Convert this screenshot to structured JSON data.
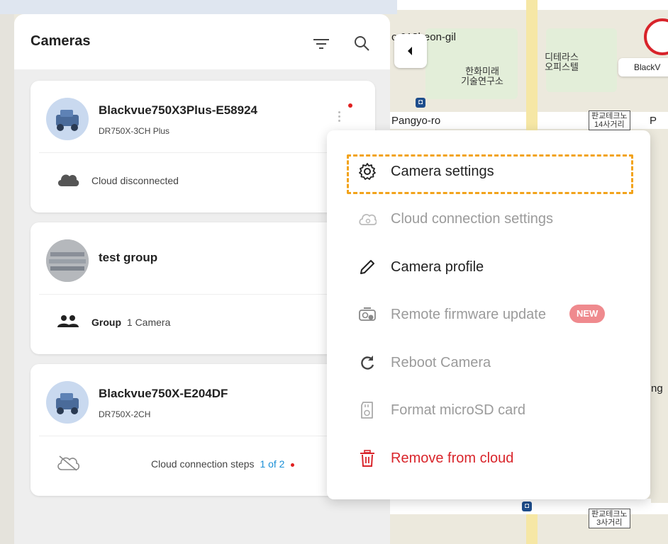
{
  "panel": {
    "title": "Cameras",
    "filter_icon": "filter-icon",
    "search_icon": "search-icon"
  },
  "cameras": [
    {
      "name": "Blackvue750X3Plus-E58924",
      "model": "DR750X-3CH Plus",
      "status": "Cloud disconnected",
      "status_icon": "cloud-filled-icon",
      "alert_color": "#e02020"
    },
    {
      "name": "test group",
      "type_label": "Group",
      "count_label": "1 Camera",
      "status_icon": "group-icon"
    },
    {
      "name": "Blackvue750X-E204DF",
      "model": "DR750X-2CH",
      "status": "Cloud connection steps",
      "steps_link": "1 of 2",
      "status_icon": "cloud-off-icon"
    }
  ],
  "menu": {
    "items": [
      {
        "label": "Camera settings",
        "icon": "gear-icon",
        "state": "enabled"
      },
      {
        "label": "Cloud connection settings",
        "icon": "cloud-settings-icon",
        "state": "disabled"
      },
      {
        "label": "Camera profile",
        "icon": "pencil-icon",
        "state": "enabled"
      },
      {
        "label": "Remote firmware update",
        "icon": "firmware-icon",
        "state": "disabled",
        "badge": "NEW"
      },
      {
        "label": "Reboot Camera",
        "icon": "reboot-icon",
        "state": "disabled"
      },
      {
        "label": "Format microSD card",
        "icon": "sd-card-icon",
        "state": "disabled"
      },
      {
        "label": "Remove from cloud",
        "icon": "trash-icon",
        "state": "danger"
      }
    ]
  },
  "map": {
    "labels": {
      "street_top": "o 013beon-gil",
      "street_pangyo": "Pangyo-ro",
      "building_hanwha": "한화미래\n기술연구소",
      "building_terrace": "디테라스\n오피스텔",
      "sign_14": "판교테크노\n14사거리",
      "sign_3": "판교테크노\n3사거리",
      "marker_label": "BlackV",
      "edge_p": "P",
      "edge_ng": "ng"
    }
  },
  "colors": {
    "accent_link": "#1a8fd6",
    "highlight": "#f2a31b",
    "danger": "#d9252b",
    "badge": "#ef8a8e"
  }
}
